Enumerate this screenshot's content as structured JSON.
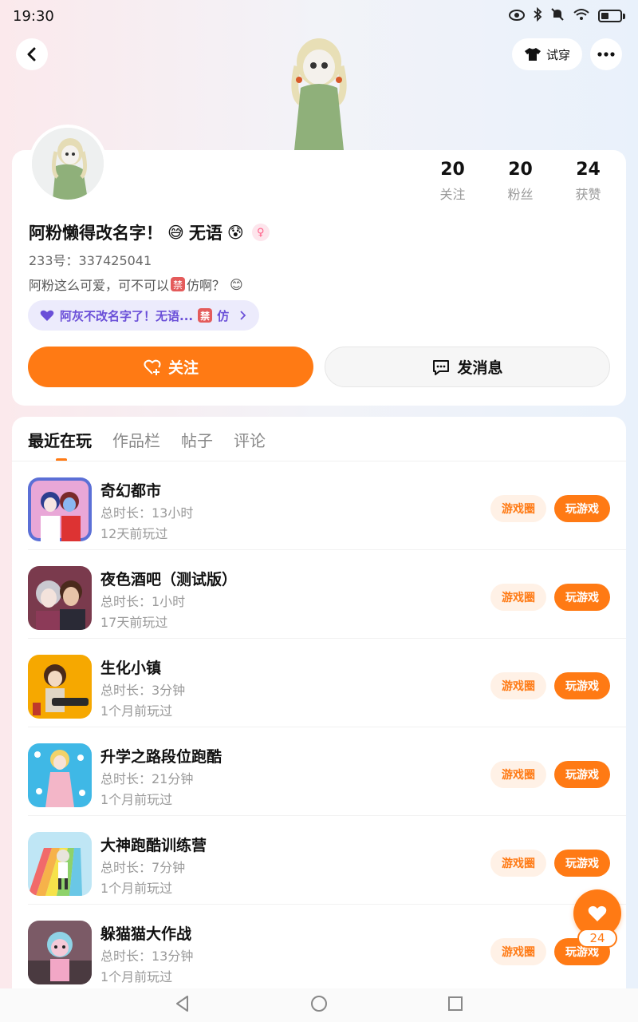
{
  "status_bar": {
    "time": "19:30",
    "icons": [
      "eye-icon",
      "bluetooth-icon",
      "mute-icon",
      "wifi-icon",
      "battery-icon"
    ]
  },
  "header": {
    "back_icon": "chevron-left-icon",
    "tryon_label": "试穿",
    "more_icon": "ellipsis-icon"
  },
  "profile": {
    "stats": [
      {
        "value": "20",
        "label": "关注"
      },
      {
        "value": "20",
        "label": "粉丝"
      },
      {
        "value": "24",
        "label": "获赞"
      }
    ],
    "nickname_part1": "阿粉懒得改名字！",
    "emoji1": "😅",
    "nickname_part2": "无语",
    "emoji2": "😰",
    "gender": "female",
    "gender_symbol": "♀",
    "user_id": "233号：337425041",
    "bio_part1": "阿粉这么可爱，可不可以",
    "bio_ban": "禁",
    "bio_part2": "仿啊？",
    "bio_emoji": "😊",
    "guild_part1": "阿灰不改名字了！无语...",
    "guild_ban": "禁",
    "guild_part2": "仿",
    "follow_label": "关注",
    "message_label": "发消息"
  },
  "tabs": [
    {
      "label": "最近在玩",
      "active": true
    },
    {
      "label": "作品栏",
      "active": false
    },
    {
      "label": "帖子",
      "active": false
    },
    {
      "label": "评论",
      "active": false
    }
  ],
  "games": [
    {
      "name": "奇幻都市",
      "time": "总时长：13小时",
      "last": "12天前玩过",
      "circle_label": "游戏圈",
      "play_label": "玩游戏",
      "icon_color": "#5b6fd6"
    },
    {
      "name": "夜色酒吧（测试版）",
      "time": "总时长：1小时",
      "last": "17天前玩过",
      "circle_label": "游戏圈",
      "play_label": "玩游戏",
      "icon_color": "#7a3a4d"
    },
    {
      "name": "生化小镇",
      "time": "总时长：3分钟",
      "last": "1个月前玩过",
      "circle_label": "游戏圈",
      "play_label": "玩游戏",
      "icon_color": "#f6a800"
    },
    {
      "name": "升学之路段位跑酷",
      "time": "总时长：21分钟",
      "last": "1个月前玩过",
      "circle_label": "游戏圈",
      "play_label": "玩游戏",
      "icon_color": "#3fb8e6"
    },
    {
      "name": "大神跑酷训练营",
      "time": "总时长：7分钟",
      "last": "1个月前玩过",
      "circle_label": "游戏圈",
      "play_label": "玩游戏",
      "icon_color": "#8ed26a"
    },
    {
      "name": "躲猫猫大作战",
      "time": "总时长：13分钟",
      "last": "1个月前玩过",
      "circle_label": "游戏圈",
      "play_label": "玩游戏",
      "icon_color": "#7b5a66"
    }
  ],
  "like_fab": {
    "count": "24"
  },
  "colors": {
    "accent": "#ff7a14",
    "guild": "#6a4fd8"
  }
}
